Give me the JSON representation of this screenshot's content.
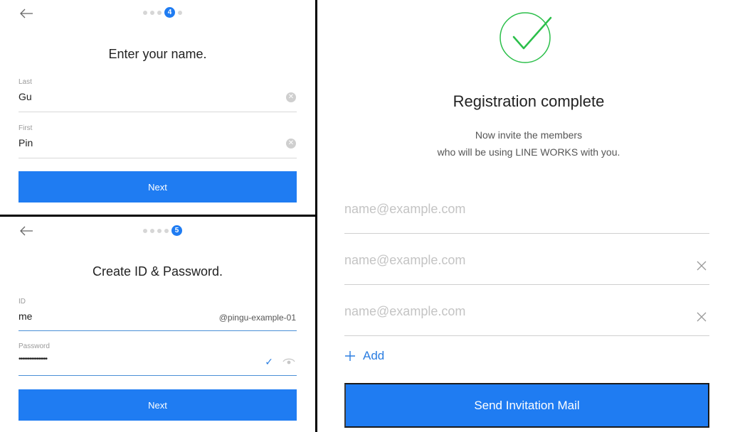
{
  "name_step": {
    "steps": [
      "",
      "",
      "",
      "4",
      ""
    ],
    "title": "Enter your name.",
    "last_label": "Last",
    "last_value": "Gu",
    "first_label": "First",
    "first_value": "Pin",
    "next_label": "Next"
  },
  "id_step": {
    "steps": [
      "",
      "",
      "",
      "",
      "5"
    ],
    "title": "Create ID & Password.",
    "id_label": "ID",
    "id_value": "me",
    "id_domain": "@pingu-example-01",
    "password_label": "Password",
    "password_value": "••••••••••••••••",
    "next_label": "Next"
  },
  "complete": {
    "title": "Registration complete",
    "desc_line1": "Now invite the members",
    "desc_line2": "who will be using LINE WORKS with you.",
    "email_placeholder": "name@example.com",
    "add_label": "Add",
    "send_label": "Send Invitation Mail"
  },
  "colors": {
    "accent": "#1f7cf2",
    "success": "#2bbf4a"
  }
}
